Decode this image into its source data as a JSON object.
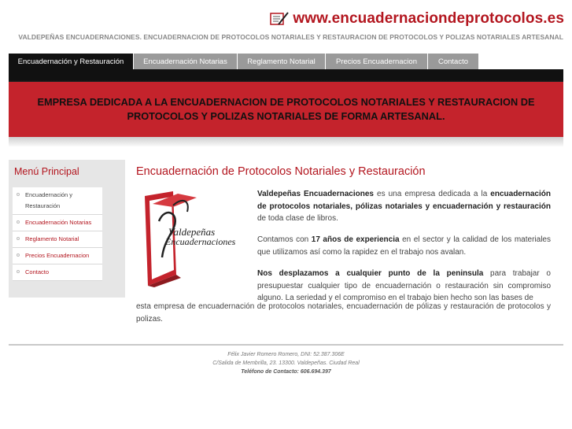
{
  "header": {
    "site_url": "www.encuadernaciondeprotocolos.es",
    "tagline": "VALDEPEÑAS ENCUADERNACIONES. ENCUADERNACION DE PROTOCOLOS NOTARIALES Y RESTAURACION DE PROTOCOLOS Y POLIZAS NOTARIALES ARTESANAL"
  },
  "nav": {
    "tabs": [
      {
        "label": "Encuadernación y Restauración",
        "active": true
      },
      {
        "label": "Encuadernación Notarias",
        "active": false
      },
      {
        "label": "Reglamento Notarial",
        "active": false
      },
      {
        "label": "Precios Encuadernacion",
        "active": false
      },
      {
        "label": "Contacto",
        "active": false
      }
    ]
  },
  "banner": {
    "text": "EMPRESA DEDICADA A LA ENCUADERNACION DE PROTOCOLOS NOTARIALES Y RESTAURACION DE PROTOCOLOS Y POLIZAS NOTARIALES DE FORMA ARTESANAL."
  },
  "sidebar": {
    "title": "Menú Principal",
    "items": [
      {
        "label": "Encuadernación y Restauración"
      },
      {
        "label": "Encuadernación Notarias"
      },
      {
        "label": "Reglamento Notarial"
      },
      {
        "label": "Precios Encuadernacion"
      },
      {
        "label": "Contacto"
      }
    ]
  },
  "main": {
    "title": "Encuadernación de Protocolos Notariales y Restauración",
    "logo_text_line1": "Valdepeñas",
    "logo_text_line2": "Encuadernaciones",
    "p1": {
      "b1": "Valdepeñas Encuadernaciones",
      "t1": " es una empresa dedicada a la ",
      "b2": "encuadernación de protocolos notariales, pólizas notariales y encuadernación y restauración",
      "t2": " de toda clase de libros."
    },
    "p2": {
      "t1": "Contamos con ",
      "b1": "17 años de experiencia",
      "t2": " en el sector y la calidad de los materiales que utilizamos así como la rapidez en el trabajo nos avalan."
    },
    "p3": {
      "b1": "Nos desplazamos a cualquier punto de la peninsula",
      "t1": " para trabajar o presupuestar cualquier tipo de encuadernación o restauración sin compromiso alguno. La seriedad y el compromiso en el trabajo bien hecho son las bases de",
      "t2": "esta empresa de encuadernación de protocolos notariales, encuadernación de pólizas y restauración de protocolos y polizas."
    }
  },
  "footer": {
    "line1": "Félix Javier Romero Romero, DNI: 52.387.306E",
    "line2": "C/Salida de Membrilla, 23. 13300. Valdepeñas. Ciudad Real",
    "line3": "Teléfono de Contacto: 606.694.397"
  },
  "colors": {
    "brand_red": "#b3161f",
    "banner_red": "#c4232c",
    "nav_active": "#111111",
    "nav_inactive": "#9a9a9a",
    "sidebar_bg": "#e6e6e6"
  },
  "icons": {
    "header_logo": "notebook-pen-icon",
    "menu_bullet": "circle-bullet-icon"
  }
}
